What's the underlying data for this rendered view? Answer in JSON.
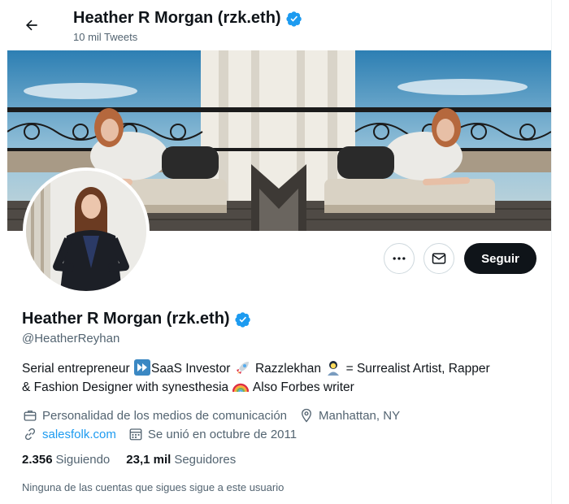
{
  "header": {
    "display_name": "Heather R Morgan (rzk.eth)",
    "tweet_count": "10 mil Tweets"
  },
  "profile": {
    "display_name": "Heather R Morgan (rzk.eth)",
    "handle": "@HeatherReyhan",
    "bio_line1_a": "Serial entrepreneur ",
    "bio_line1_b": "SaaS Investor ",
    "bio_line1_c": "  Razzlekhan ",
    "bio_line1_d": " = Surrealist Artist, Rapper",
    "bio_line2_a": "& Fashion Designer with synesthesia ",
    "bio_line2_b": " Also Forbes writer",
    "category": "Personalidad de los medios de comunicación",
    "location": "Manhattan, NY",
    "website": "salesfolk.com",
    "joined": "Se unió en octubre de 2011",
    "following_count": "2.356",
    "following_label": "Siguiendo",
    "followers_count": "23,1 mil",
    "followers_label": "Seguidores",
    "mutuals_note": "Ninguna de las cuentas que sigues sigue a este usuario"
  },
  "actions": {
    "follow_label": "Seguir"
  },
  "icons": {
    "back": "arrow-left-icon",
    "verified": "verified-badge-icon",
    "more": "more-dots-icon",
    "message": "envelope-icon",
    "category": "briefcase-icon",
    "location": "location-pin-icon",
    "website": "link-icon",
    "joined": "calendar-icon"
  },
  "colors": {
    "accent": "#1d9bf0",
    "text_primary": "#0f1419",
    "text_secondary": "#536471",
    "follow_button": "#0f1419"
  }
}
